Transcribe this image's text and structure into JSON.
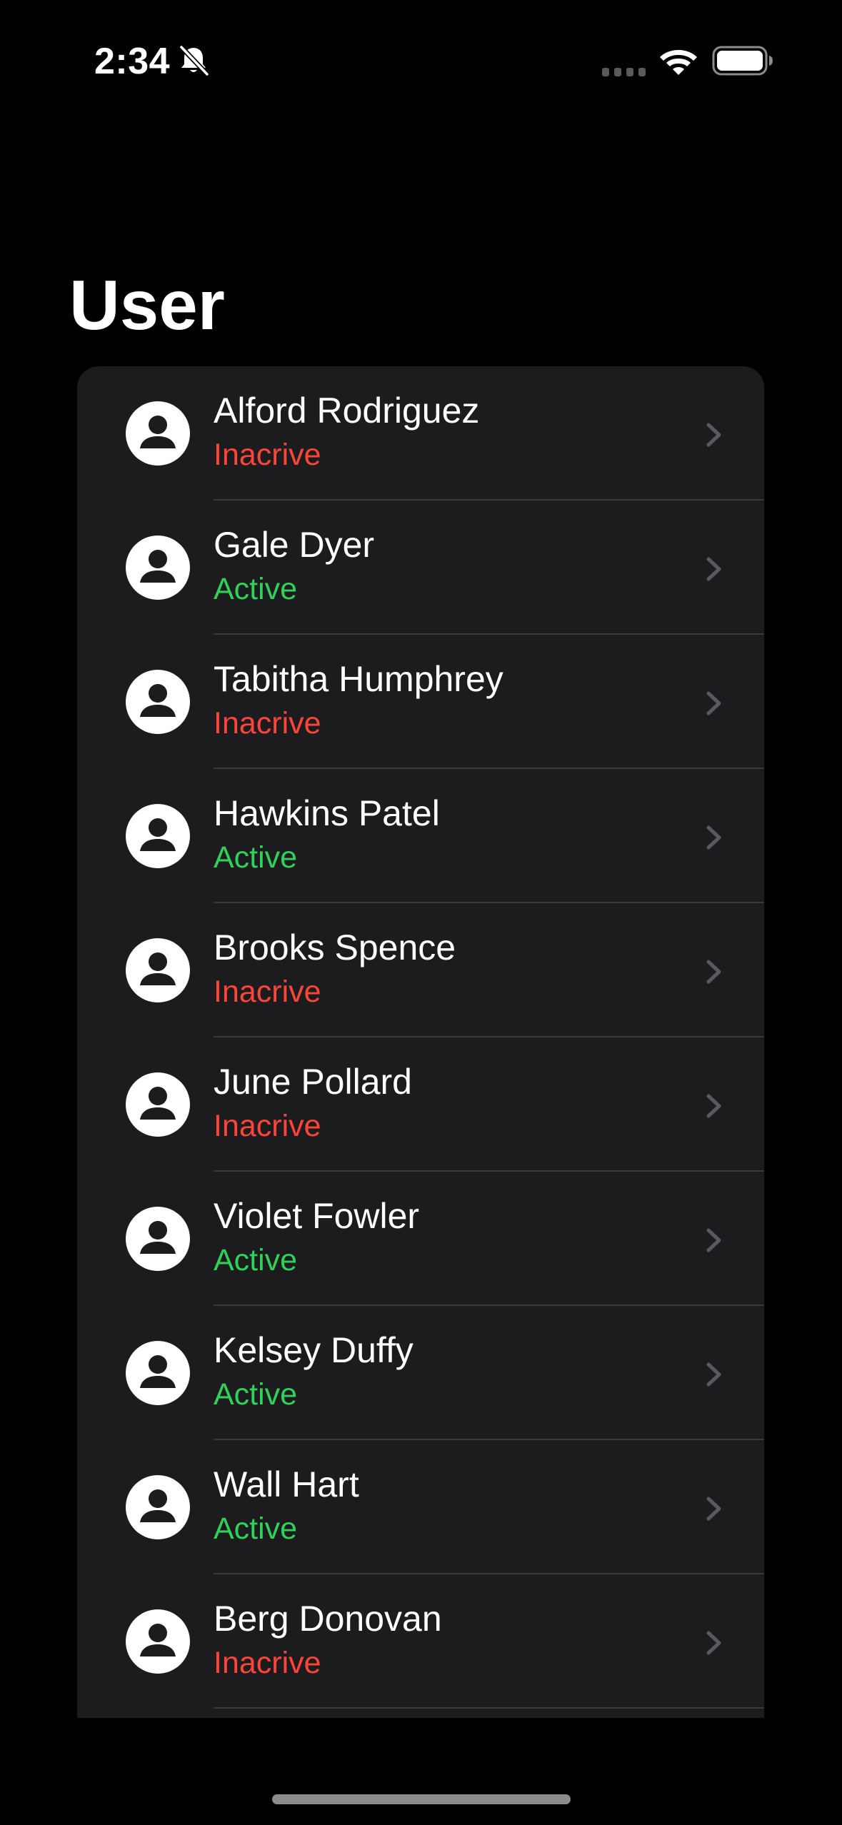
{
  "status_bar": {
    "time": "2:34",
    "icons": [
      "bell-slash-icon",
      "cellular-signal-icon",
      "wifi-icon",
      "battery-icon"
    ]
  },
  "title": "User",
  "users": [
    {
      "name": "Alford Rodriguez",
      "status": "Inacrive",
      "active": false
    },
    {
      "name": "Gale Dyer",
      "status": "Active",
      "active": true
    },
    {
      "name": "Tabitha Humphrey",
      "status": "Inacrive",
      "active": false
    },
    {
      "name": "Hawkins Patel",
      "status": "Active",
      "active": true
    },
    {
      "name": "Brooks Spence",
      "status": "Inacrive",
      "active": false
    },
    {
      "name": "June Pollard",
      "status": "Inacrive",
      "active": false
    },
    {
      "name": "Violet Fowler",
      "status": "Active",
      "active": true
    },
    {
      "name": "Kelsey Duffy",
      "status": "Active",
      "active": true
    },
    {
      "name": "Wall Hart",
      "status": "Active",
      "active": true
    },
    {
      "name": "Berg Donovan",
      "status": "Inacrive",
      "active": false
    }
  ],
  "colors": {
    "background": "#000000",
    "card": "#1c1c1e",
    "active": "#30d158",
    "inactive": "#ff453a",
    "separator": "#38383a",
    "chevron": "#5a5a5e"
  }
}
